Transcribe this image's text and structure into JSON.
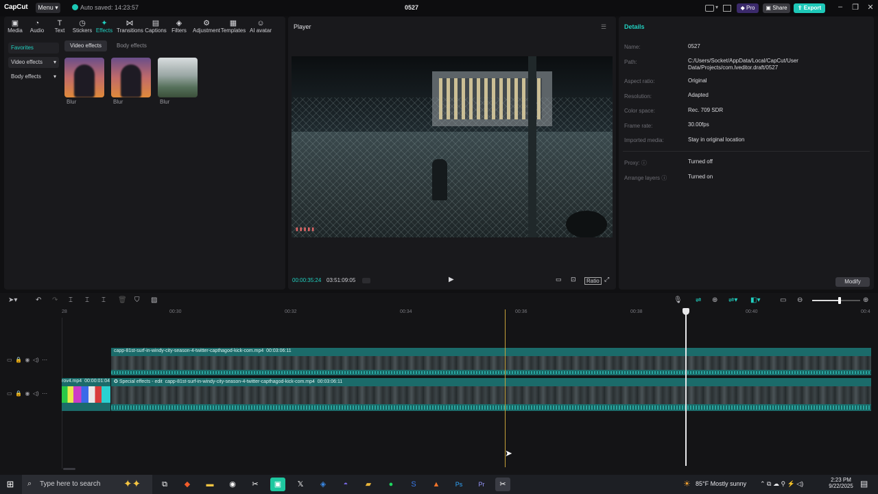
{
  "titlebar": {
    "logo": "CapCut",
    "menu": "Menu",
    "autosave": "Auto saved: 14:23:57",
    "project": "0527",
    "pro": "Pro",
    "share": "Share",
    "export": "Export"
  },
  "toolbar": [
    {
      "label": "Media",
      "icon": "media-icon"
    },
    {
      "label": "Audio",
      "icon": "audio-icon"
    },
    {
      "label": "Text",
      "icon": "text-icon"
    },
    {
      "label": "Stickers",
      "icon": "stickers-icon"
    },
    {
      "label": "Effects",
      "icon": "effects-icon"
    },
    {
      "label": "Transitions",
      "icon": "transitions-icon"
    },
    {
      "label": "Captions",
      "icon": "captions-icon"
    },
    {
      "label": "Filters",
      "icon": "filters-icon"
    },
    {
      "label": "Adjustment",
      "icon": "adjustment-icon"
    },
    {
      "label": "Templates",
      "icon": "templates-icon"
    },
    {
      "label": "AI avatar",
      "icon": "ai-avatar-icon"
    }
  ],
  "sidebar": {
    "favorites": "Favorites",
    "video_effects": "Video effects",
    "body_effects": "Body effects"
  },
  "effects": {
    "tab_video": "Video effects",
    "tab_body": "Body effects",
    "items": [
      {
        "label": "Blur"
      },
      {
        "label": "Blur"
      },
      {
        "label": "Blur"
      }
    ]
  },
  "player": {
    "title": "Player",
    "current_time": "00:00:35:24",
    "total_time": "03:51:09:05"
  },
  "details": {
    "title": "Details",
    "rows": [
      {
        "label": "Name:",
        "value": "0527"
      },
      {
        "label": "Path:",
        "value": "C:/Users/Socket/AppData/Local/CapCut/User Data/Projects/com.lveditor.draft/0527"
      },
      {
        "label": "Aspect ratio:",
        "value": "Original"
      },
      {
        "label": "Resolution:",
        "value": "Adapted"
      },
      {
        "label": "Color space:",
        "value": "Rec. 709 SDR"
      },
      {
        "label": "Frame rate:",
        "value": "30.00fps"
      },
      {
        "label": "Imported media:",
        "value": "Stay in original location"
      },
      {
        "label": "Proxy:",
        "value": "Turned off"
      },
      {
        "label": "Arrange layers",
        "value": "Turned on"
      }
    ],
    "modify": "Modify"
  },
  "timeline": {
    "ruler": [
      "28",
      "00:30",
      "00:32",
      "00:34",
      "00:36",
      "00:38",
      "00:40",
      "00:4"
    ],
    "track1_clip": "capp-81st-surf-in-windy-city-season-4-twitter-capthagod-kick-com.mp4",
    "track1_duration": "00:03:06:11",
    "track2_prev_clip": "rov4.mp4",
    "track2_prev_duration": "00:00:01:04",
    "track2_effect": "Special effects - edit",
    "track2_clip": "capp-81st-surf-in-windy-city-season-4-twitter-capthagod-kick-com.mp4",
    "track2_duration": "00:03:06:11"
  },
  "taskbar": {
    "search_placeholder": "Type here to search",
    "weather": "85°F  Mostly sunny",
    "time": "2:23 PM",
    "date": "9/22/2025"
  },
  "colors": {
    "accent": "#21d0c0",
    "clip": "#1b6b6a",
    "playhead": "#c8a23a"
  }
}
